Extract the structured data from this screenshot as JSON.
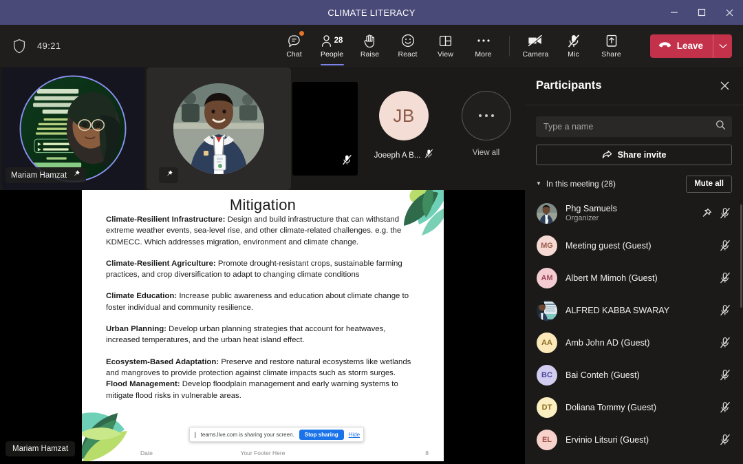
{
  "window": {
    "title": "CLIMATE LITERACY",
    "controls": [
      {
        "name": "minimize",
        "glyph": "minimize-icon"
      },
      {
        "name": "maximize",
        "glyph": "maximize-icon"
      },
      {
        "name": "close",
        "glyph": "close-icon"
      }
    ]
  },
  "toolbar": {
    "shield_icon": "shield-icon",
    "timer": "49:21",
    "items": [
      {
        "label": "Chat",
        "icon": "chat-icon",
        "active": false,
        "has_dot": true
      },
      {
        "label": "People",
        "icon": "people-icon",
        "active": true,
        "count": "28"
      },
      {
        "label": "Raise",
        "icon": "raise-hand-icon",
        "active": false
      },
      {
        "label": "React",
        "icon": "react-icon",
        "active": false
      },
      {
        "label": "View",
        "icon": "view-icon",
        "active": false
      },
      {
        "label": "More",
        "icon": "more-icon",
        "active": false
      }
    ],
    "device_items": [
      {
        "label": "Camera",
        "icon": "camera-off-icon",
        "state": "off"
      },
      {
        "label": "Mic",
        "icon": "mic-off-icon",
        "state": "off"
      },
      {
        "label": "Share",
        "icon": "share-screen-icon",
        "state": "on"
      }
    ],
    "leave_label": "Leave",
    "leave_icon": "hangup-icon",
    "leave_caret_icon": "chevron-down-icon",
    "accent_purple": "#7b83eb",
    "leave_red": "#c4314b"
  },
  "stage": {
    "tiles": [
      {
        "name": "Mariam Hamzat",
        "type": "video",
        "speaking": true,
        "pinned": true,
        "pin_icon": "pin-icon"
      },
      {
        "name": "",
        "type": "video",
        "speaking": false,
        "pinned": true,
        "pin_icon": "pin-icon"
      },
      {
        "name": "",
        "type": "video-black",
        "muted": true,
        "mic_icon": "mic-off-icon"
      },
      {
        "name": "Joeeph A B...",
        "type": "avatar",
        "initials": "JB",
        "avatar_color": "#f4ddd5",
        "initials_color": "#8d5a4a",
        "muted": true,
        "mic_icon": "mic-off-icon"
      },
      {
        "name": "View all",
        "type": "overflow",
        "icon": "ellipsis-icon"
      }
    ],
    "presenter_label": "Mariam Hamzat"
  },
  "slide": {
    "title": "Mitigation",
    "paragraphs": [
      {
        "heading": "Climate-Resilient Infrastructure:",
        "text": " Design and build infrastructure that can withstand extreme weather events, sea-level rise, and other climate-related challenges. e.g. the KDMECC. Which addresses migration, environment and climate change."
      },
      {
        "heading": "Climate-Resilient Agriculture:",
        "text": " Promote drought-resistant crops, sustainable farming practices, and crop diversification to adapt to changing climate conditions"
      },
      {
        "heading": "Climate Education:",
        "text": " Increase public awareness and education about climate change to foster individual and community resilience."
      },
      {
        "heading": "Urban Planning:",
        "text": " Develop urban planning strategies that account for heatwaves, increased temperatures, and the urban heat island effect."
      },
      {
        "heading": "Ecosystem-Based Adaptation:",
        "text": " Preserve and restore natural ecosystems like wetlands and mangroves to provide protection against climate impacts such as storm surges."
      },
      {
        "heading": "Flood Management:",
        "text": " Develop floodplain management and early warning systems to mitigate flood risks in vulnerable areas."
      }
    ],
    "footer": {
      "date": "Date",
      "center": "Your Footer Here",
      "page": "8"
    },
    "leaf_colors": [
      "#b9dd6b",
      "#6fd0b8",
      "#2f6b4b",
      "#3f8c5e",
      "#c8e88a"
    ]
  },
  "sharebar": {
    "grip_icon": "drag-grip-icon",
    "message": "teams.live.com is sharing your screen.",
    "stop_label": "Stop sharing",
    "hide_label": "Hide",
    "accent": "#1a73e8"
  },
  "participants": {
    "panel_title": "Participants",
    "close_icon": "close-icon",
    "search": {
      "placeholder": "Type a name",
      "value": "",
      "icon": "search-icon"
    },
    "share_invite": {
      "label": "Share invite",
      "icon": "share-invite-icon"
    },
    "section": {
      "caret_icon": "caret-down-icon",
      "label": "In this meeting (28)",
      "mute_all_label": "Mute all"
    },
    "list": [
      {
        "name": "Phg Samuels",
        "role": "Organizer",
        "avatar_type": "photo",
        "avatar_color": "#3f5a78",
        "initials": "",
        "actions": [
          "pin-icon",
          "mic-off-icon"
        ]
      },
      {
        "name": "Meeting guest (Guest)",
        "role": "",
        "avatar_type": "initials",
        "avatar_color": "#f5d9d2",
        "initials": "MG",
        "initials_color": "#9b5c4e",
        "actions": [
          "mic-off-icon"
        ]
      },
      {
        "name": "Albert M Mimoh (Guest)",
        "role": "",
        "avatar_type": "initials",
        "avatar_color": "#f3ccd2",
        "initials": "AM",
        "initials_color": "#a04a5c",
        "actions": [
          "mic-off-icon"
        ]
      },
      {
        "name": "ALFRED KABBA SWARAY",
        "role": "",
        "avatar_type": "photo",
        "avatar_color": "#4a6a7a",
        "initials": "",
        "actions": [
          "mic-off-icon"
        ]
      },
      {
        "name": "Amb John AD (Guest)",
        "role": "",
        "avatar_type": "initials",
        "avatar_color": "#fbe8b8",
        "initials": "AA",
        "initials_color": "#8a6b1f",
        "actions": [
          "mic-off-icon"
        ]
      },
      {
        "name": "Bai Conteh (Guest)",
        "role": "",
        "avatar_type": "initials",
        "avatar_color": "#d2cdf0",
        "initials": "BC",
        "initials_color": "#4a4599",
        "actions": [
          "mic-off-icon"
        ]
      },
      {
        "name": "Doliana Tommy (Guest)",
        "role": "",
        "avatar_type": "initials",
        "avatar_color": "#fbeec0",
        "initials": "DT",
        "initials_color": "#8a6b1f",
        "actions": [
          "mic-off-icon"
        ]
      },
      {
        "name": "Ervinio Litsuri (Guest)",
        "role": "",
        "avatar_type": "initials",
        "avatar_color": "#f6d2cb",
        "initials": "EL",
        "initials_color": "#9e4e44",
        "actions": [
          "mic-off-icon"
        ]
      }
    ]
  }
}
